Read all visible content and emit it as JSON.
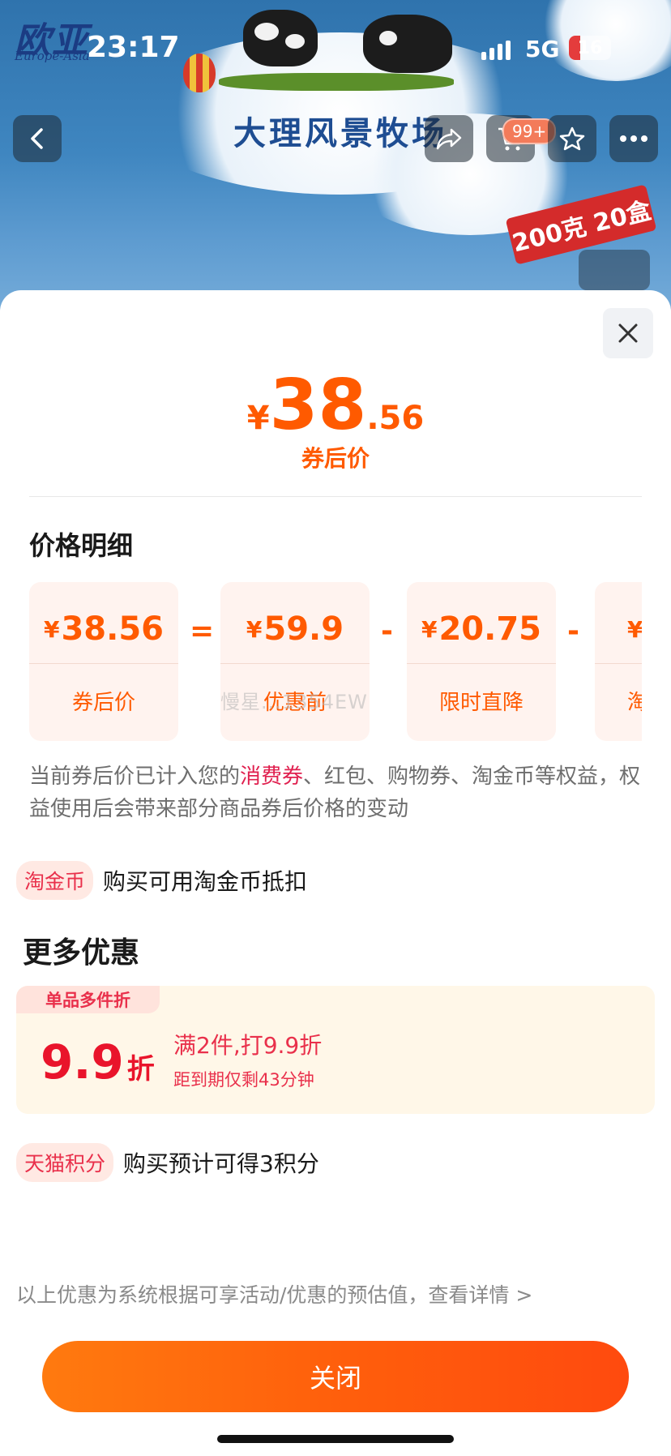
{
  "status_bar": {
    "time": "23:17",
    "network": "5G",
    "battery": "16"
  },
  "hero": {
    "brand_logo": "欧亚",
    "brand_sub": "Europe-Asia",
    "farm_title": "大理风景牧场",
    "banner_text": "200克 20盒",
    "cart_badge": "99+"
  },
  "sheet": {
    "price": {
      "currency": "¥",
      "integer": "38",
      "decimal": ".56",
      "label": "券后价"
    },
    "breakdown_title": "价格明细",
    "breakdown": [
      {
        "currency": "¥",
        "amount": "38.56",
        "label": "券后价"
      },
      {
        "currency": "¥",
        "amount": "59.9",
        "label": "优惠前"
      },
      {
        "currency": "¥",
        "amount": "20.75",
        "label": "限时直降"
      },
      {
        "currency": "¥",
        "amount": "",
        "label": "淘抵"
      }
    ],
    "operators": [
      "=",
      "-",
      "-"
    ],
    "watermark": "慢星...1354EW",
    "note": {
      "prefix": "当前券后价已计入您的",
      "highlight": "消费券",
      "suffix": "、红包、购物券、淘金币等权益，权益使用后会带来部分商品券后价格的变动"
    },
    "taojinbi": {
      "tag": "淘金币",
      "text": "购买可用淘金币抵扣"
    },
    "more_title": "更多优惠",
    "promo": {
      "tag": "单品多件折",
      "number": "9.9",
      "unit": "折",
      "line1": "满2件,打9.9折",
      "line2": "距到期仅剩43分钟"
    },
    "tmall_points": {
      "tag": "天猫积分",
      "text": "购买预计可得3积分"
    },
    "footer_note": "以上优惠为系统根据可享活动/优惠的预估值，查看详情 >",
    "close_button": "关闭"
  },
  "colors": {
    "accent": "#ff5a00",
    "highlight_red": "#e9304b",
    "sheet_bg": "#ffffff",
    "card_bg": "#fff3ef",
    "promo_bg": "#fff7e8"
  }
}
